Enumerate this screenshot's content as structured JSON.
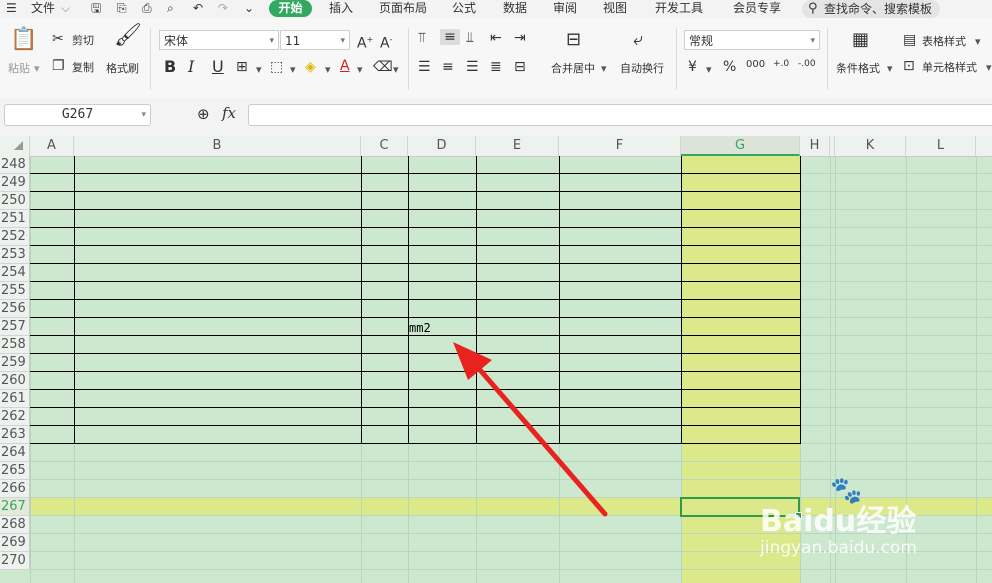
{
  "menubar": {
    "file_label": "文件",
    "tabs": [
      "开始",
      "插入",
      "页面布局",
      "公式",
      "数据",
      "审阅",
      "视图",
      "开发工具",
      "会员专享"
    ],
    "search_placeholder": "查找命令、搜索模板"
  },
  "ribbon": {
    "paste": "粘贴",
    "cut": "剪切",
    "copy": "复制",
    "format_painter": "格式刷",
    "font_name": "宋体",
    "font_size": "11",
    "bold": "B",
    "italic": "I",
    "underline": "U",
    "merge_center": "合并居中",
    "wrap_text": "自动换行",
    "number_format": "常规",
    "currency": "¥",
    "percent": "%",
    "thousands": "000",
    "inc_decimal": "+.0",
    "dec_decimal": "-.00",
    "cond_format": "条件格式",
    "table_style": "表格样式",
    "cell_style": "单元格样式"
  },
  "formula_bar": {
    "name_box": "G267",
    "fx": "fx",
    "formula_value": ""
  },
  "sheet": {
    "columns": [
      "A",
      "B",
      "C",
      "D",
      "E",
      "F",
      "G",
      "H",
      "K",
      "L"
    ],
    "active_column": "G",
    "active_row": "267",
    "rows": [
      "248",
      "249",
      "250",
      "251",
      "252",
      "253",
      "254",
      "255",
      "256",
      "257",
      "258",
      "259",
      "260",
      "261",
      "262",
      "263",
      "264",
      "265",
      "266",
      "267",
      "268",
      "269",
      "270"
    ],
    "cell_D257": "mm2"
  },
  "watermark": {
    "brand": "Baidu经验",
    "url": "jingyan.baidu.com"
  },
  "colors": {
    "sheet_bg": "#cce8cf",
    "selection_highlight": "#dce98a",
    "accent_green": "#33a860",
    "arrow": "#e8231f"
  }
}
